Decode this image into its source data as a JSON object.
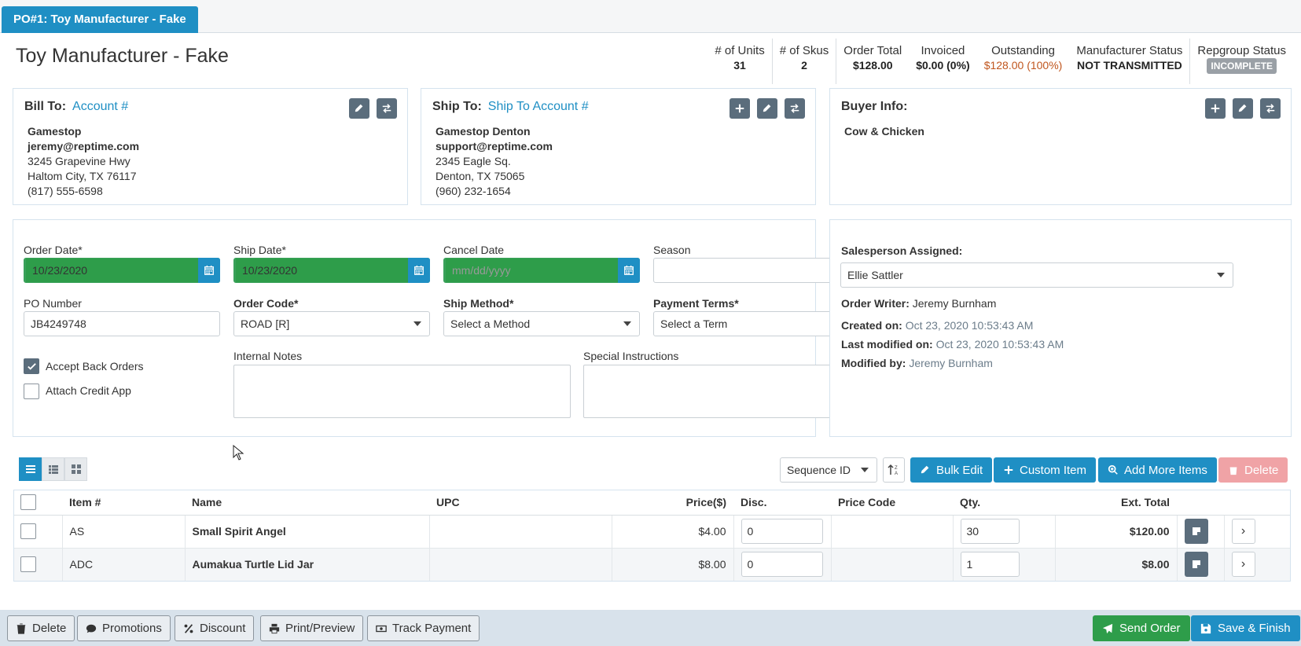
{
  "tab": {
    "label": "PO#1: Toy Manufacturer - Fake"
  },
  "header": {
    "title": "Toy Manufacturer - Fake"
  },
  "stats": [
    {
      "label": "# of Units",
      "value": "31"
    },
    {
      "label": "# of Skus",
      "value": "2"
    },
    {
      "label": "Order Total",
      "value": "$128.00"
    },
    {
      "label": "Invoiced",
      "value": "$0.00 (0%)"
    },
    {
      "label": "Outstanding",
      "value": "$128.00 (100%)"
    },
    {
      "label": "Manufacturer Status",
      "value": "NOT TRANSMITTED"
    },
    {
      "label": "Repgroup Status",
      "value": "INCOMPLETE"
    }
  ],
  "bill_to": {
    "heading": "Bill To:",
    "link": "Account #",
    "name": "Gamestop",
    "email": "jeremy@reptime.com",
    "street": "3245 Grapevine Hwy",
    "city": "Haltom City, TX 76117",
    "phone": "(817) 555-6598"
  },
  "ship_to": {
    "heading": "Ship To:",
    "link": "Ship To Account #",
    "name": "Gamestop Denton",
    "email": "support@reptime.com",
    "street": "2345 Eagle Sq.",
    "city": "Denton, TX 75065",
    "phone": "(960) 232-1654"
  },
  "buyer": {
    "heading": "Buyer Info:",
    "name": "Cow & Chicken"
  },
  "form": {
    "order_date_label": "Order Date*",
    "order_date": "10/23/2020",
    "ship_date_label": "Ship Date*",
    "ship_date": "10/23/2020",
    "cancel_date_label": "Cancel Date",
    "cancel_date_placeholder": "mm/dd/yyyy",
    "season_label": "Season",
    "season": "",
    "po_number_label": "PO Number",
    "po_number": "JB4249748",
    "order_code_label": "Order Code*",
    "order_code": "ROAD [R]",
    "ship_method_label": "Ship Method*",
    "ship_method": "Select a Method",
    "payment_terms_label": "Payment Terms*",
    "payment_terms": "Select a Term",
    "accept_back_orders": "Accept Back Orders",
    "attach_credit_app": "Attach Credit App",
    "internal_notes_label": "Internal Notes",
    "special_instructions_label": "Special Instructions"
  },
  "sales": {
    "salesperson_label": "Salesperson Assigned:",
    "salesperson": "Ellie Sattler",
    "order_writer_label": "Order Writer:",
    "order_writer": "Jeremy Burnham",
    "created_label": "Created on:",
    "created": "Oct 23, 2020 10:53:43 AM",
    "modified_label": "Last modified on:",
    "modified": "Oct 23, 2020 10:53:43 AM",
    "modified_by_label": "Modified by:",
    "modified_by": "Jeremy Burnham"
  },
  "toolbar": {
    "sort": "Sequence ID",
    "bulk_edit": "Bulk Edit",
    "custom_item": "Custom Item",
    "add_more": "Add More Items",
    "delete": "Delete"
  },
  "table": {
    "headers": {
      "item": "Item #",
      "name": "Name",
      "upc": "UPC",
      "price": "Price($)",
      "disc": "Disc.",
      "price_code": "Price Code",
      "qty": "Qty.",
      "ext_total": "Ext. Total"
    },
    "rows": [
      {
        "item": "AS",
        "name": "Small Spirit Angel",
        "upc": "",
        "price": "$4.00",
        "disc": "0",
        "price_code": "",
        "qty": "30",
        "ext_total": "$120.00"
      },
      {
        "item": "ADC",
        "name": "Aumakua Turtle Lid Jar",
        "upc": "",
        "price": "$8.00",
        "disc": "0",
        "price_code": "",
        "qty": "1",
        "ext_total": "$8.00"
      }
    ]
  },
  "footer": {
    "delete": "Delete",
    "promotions": "Promotions",
    "discount": "Discount",
    "print": "Print/Preview",
    "track_payment": "Track Payment",
    "send_order": "Send Order",
    "save_finish": "Save & Finish"
  },
  "colors": {
    "accent": "#1f8fc4",
    "success": "#2e9d4a",
    "outstanding": "#c0561e",
    "icon_button": "#5b6d7c"
  }
}
